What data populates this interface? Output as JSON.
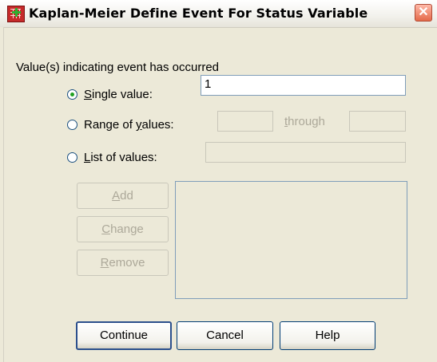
{
  "window": {
    "title": "Kaplan-Meier Define Event For Status Variable",
    "close_glyph": "✕",
    "app_icon": "spss-table-icon"
  },
  "group": {
    "label": "Value(s) indicating event has occurred"
  },
  "options": {
    "single": {
      "prefix": "",
      "mnemonic": "S",
      "rest": "ingle value:",
      "selected": true,
      "value": "1"
    },
    "range": {
      "prefix": "Range of ",
      "mnemonic": "y",
      "rest": "alues:",
      "selected": false,
      "from": "",
      "to": ""
    },
    "list": {
      "prefix": "",
      "mnemonic": "L",
      "rest": "ist of values:",
      "selected": false,
      "value": ""
    }
  },
  "through_label": {
    "mnemonic": "t",
    "rest": "hrough"
  },
  "list_buttons": {
    "add": {
      "prefix": "",
      "mnemonic": "A",
      "rest": "dd",
      "enabled": false
    },
    "change": {
      "prefix": "",
      "mnemonic": "C",
      "rest": "hange",
      "enabled": false
    },
    "remove": {
      "prefix": "",
      "mnemonic": "R",
      "rest": "emove",
      "enabled": false
    }
  },
  "values_list": {
    "items": []
  },
  "footer": {
    "continue_label": "Continue",
    "cancel_label": "Cancel",
    "help_label": "Help"
  }
}
